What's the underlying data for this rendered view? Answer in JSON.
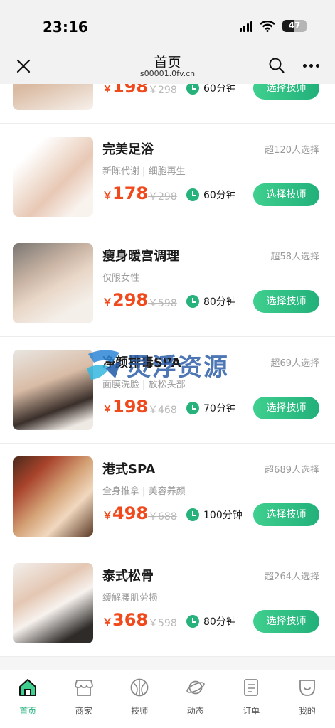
{
  "status": {
    "time": "23:16",
    "battery": "47"
  },
  "nav": {
    "title": "首页",
    "subtitle": "s00001.0fv.cn"
  },
  "items": [
    {
      "name": "",
      "count": "",
      "desc": "",
      "price": "198",
      "old": "￥298",
      "duration": "60分钟",
      "button": "选择技师"
    },
    {
      "name": "完美足浴",
      "count": "超120人选择",
      "desc": "新陈代谢 | 细胞再生",
      "price": "178",
      "old": "￥298",
      "duration": "60分钟",
      "button": "选择技师"
    },
    {
      "name": "瘦身暖宫调理",
      "count": "超58人选择",
      "desc": "仅限女性",
      "price": "298",
      "old": "￥598",
      "duration": "80分钟",
      "button": "选择技师"
    },
    {
      "name": "净颜排毒SPA",
      "count": "超69人选择",
      "desc": "面膜洗脸 | 放松头部",
      "price": "198",
      "old": "￥468",
      "duration": "70分钟",
      "button": "选择技师"
    },
    {
      "name": "港式SPA",
      "count": "超689人选择",
      "desc": "全身推拿 | 美容养颜",
      "price": "498",
      "old": "￥688",
      "duration": "100分钟",
      "button": "选择技师"
    },
    {
      "name": "泰式松骨",
      "count": "超264人选择",
      "desc": "缓解腰肌劳损",
      "price": "368",
      "old": "￥598",
      "duration": "80分钟",
      "button": "选择技师"
    }
  ],
  "currency": "￥",
  "watermark": "灵浮资源",
  "tabs": [
    {
      "label": "首页",
      "icon": "home-icon"
    },
    {
      "label": "商家",
      "icon": "shop-icon"
    },
    {
      "label": "技师",
      "icon": "technician-icon"
    },
    {
      "label": "动态",
      "icon": "planet-icon"
    },
    {
      "label": "订单",
      "icon": "order-icon"
    },
    {
      "label": "我的",
      "icon": "profile-icon"
    }
  ],
  "colors": {
    "accent": "#22b07a",
    "price": "#f04a1c"
  }
}
